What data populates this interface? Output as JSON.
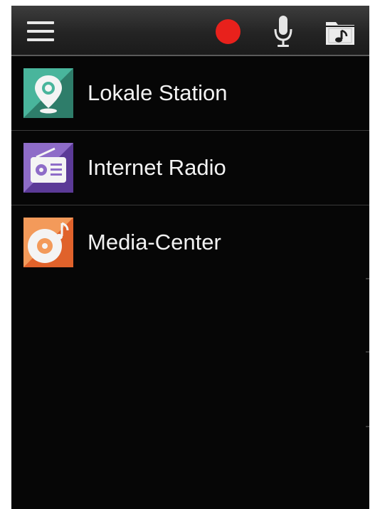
{
  "toolbar": {
    "menu_icon": "hamburger-menu-icon",
    "record_icon": "record-icon",
    "record_color": "#e8211c",
    "mic_icon": "microphone-icon",
    "folder_icon": "music-folder-icon"
  },
  "menu": {
    "items": [
      {
        "label": "Lokale Station",
        "icon": "location-pin-icon",
        "colors": [
          "#49b59c",
          "#2e7d6a"
        ]
      },
      {
        "label": "Internet Radio",
        "icon": "radio-icon",
        "colors": [
          "#8e6cc8",
          "#5b3a97"
        ]
      },
      {
        "label": "Media-Center",
        "icon": "music-disc-icon",
        "colors": [
          "#f39a5a",
          "#e0622b"
        ]
      }
    ]
  }
}
